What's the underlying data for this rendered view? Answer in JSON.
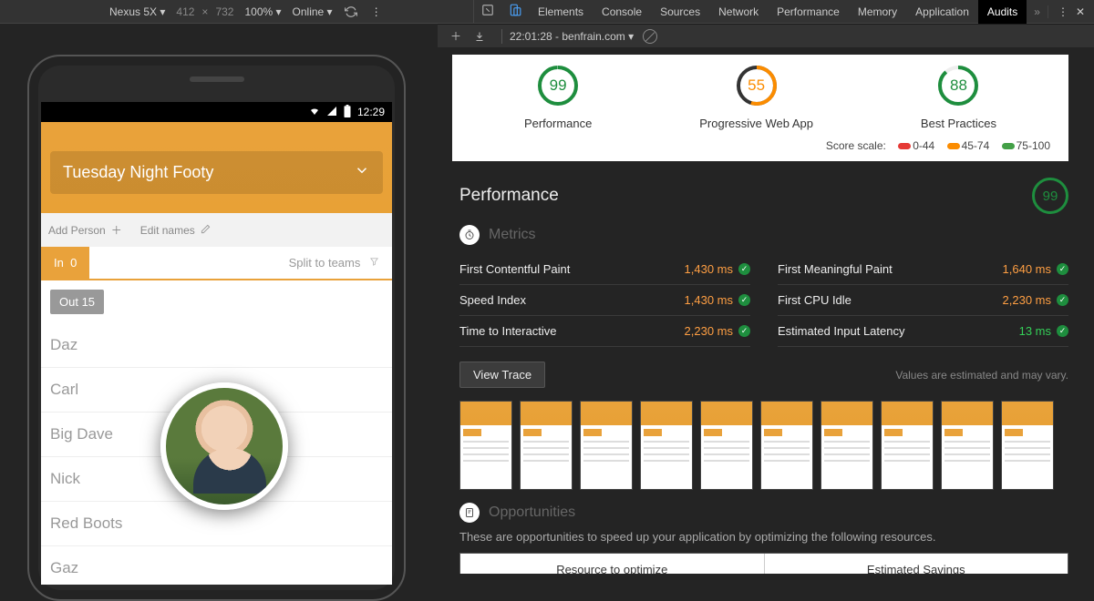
{
  "toolbar": {
    "device": "Nexus 5X ▾",
    "width": "412",
    "height": "732",
    "zoom": "100% ▾",
    "online": "Online ▾"
  },
  "devtools_tabs": [
    "Elements",
    "Console",
    "Sources",
    "Network",
    "Performance",
    "Memory",
    "Application",
    "Audits"
  ],
  "active_tab": "Audits",
  "audit_bar": {
    "label": "22:01:28 - benfrain.com ▾"
  },
  "phone": {
    "time": "12:29",
    "app_title": "Tuesday Night Footy",
    "add_person": "Add Person",
    "edit_names": "Edit names",
    "tab_in": "In",
    "tab_in_count": "0",
    "split": "Split to teams",
    "out_pill": "Out  15",
    "people": [
      "Daz",
      "Carl",
      "Big Dave",
      "Nick",
      "Red Boots",
      "Gaz"
    ]
  },
  "scores": {
    "items": [
      {
        "label": "Performance",
        "value": "99",
        "color": "#1e8e3e"
      },
      {
        "label": "Progressive Web App",
        "value": "55",
        "color": "#fb8c00"
      },
      {
        "label": "Best Practices",
        "value": "88",
        "color": "#1e8e3e"
      }
    ],
    "scale_label": "Score scale:",
    "scale": [
      "0-44",
      "45-74",
      "75-100"
    ]
  },
  "performance": {
    "title": "Performance",
    "score": "99",
    "metrics_label": "Metrics",
    "metrics": [
      {
        "label": "First Contentful Paint",
        "value": "1,430 ms"
      },
      {
        "label": "First Meaningful Paint",
        "value": "1,640 ms"
      },
      {
        "label": "Speed Index",
        "value": "1,430 ms"
      },
      {
        "label": "First CPU Idle",
        "value": "2,230 ms"
      },
      {
        "label": "Time to Interactive",
        "value": "2,230 ms"
      },
      {
        "label": "Estimated Input Latency",
        "value": "13 ms",
        "green": true
      }
    ],
    "view_trace": "View Trace",
    "estimated_note": "Values are estimated and may vary.",
    "opportunities_label": "Opportunities",
    "opp_desc": "These are opportunities to speed up your application by optimizing the following resources.",
    "opp_cols": [
      "Resource to optimize",
      "Estimated Savings"
    ]
  }
}
